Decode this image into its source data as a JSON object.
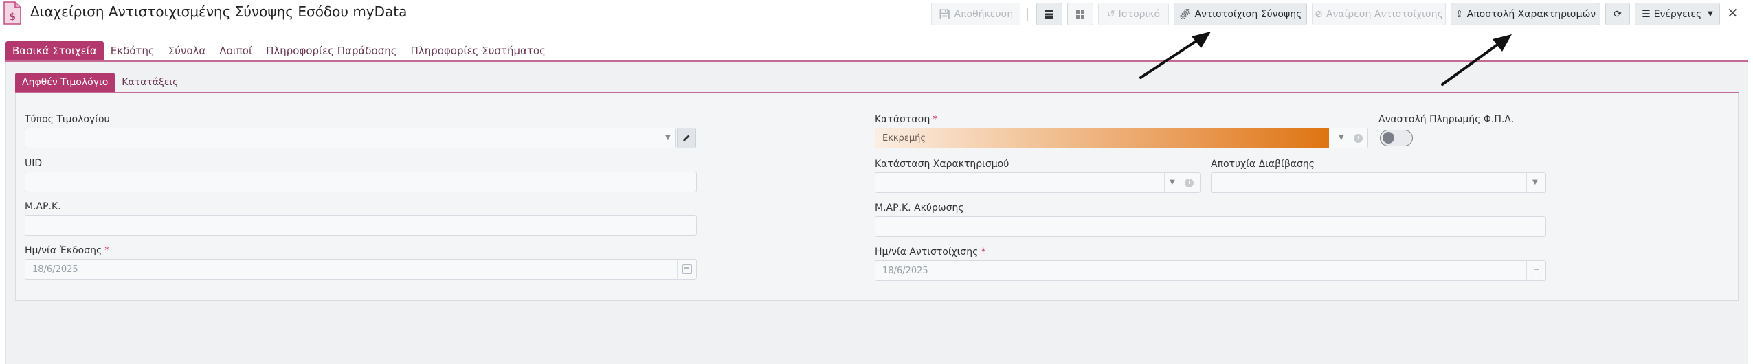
{
  "header": {
    "title": "Διαχείριση Αντιστοιχισμένης Σύνοψης Εσόδου myData",
    "icon": "document-dollar-icon",
    "accent": "#b3386e"
  },
  "toolbar": {
    "save_label": "Αποθήκευση",
    "history_label": "Ιστορικό",
    "match_label": "Αντιστοίχιση Σύνοψης",
    "unmatch_label": "Αναίρεση Αντιστοίχισης",
    "send_label": "Αποστολή Χαρακτηρισμών",
    "actions_label": "Ενέργειες",
    "close_symbol": "×"
  },
  "main_tabs": [
    {
      "label": "Βασικά Στοιχεία"
    },
    {
      "label": "Εκδότης"
    },
    {
      "label": "Σύνολα"
    },
    {
      "label": "Λοιποί"
    },
    {
      "label": "Πληροφορίες Παράδοσης"
    },
    {
      "label": "Πληροφορίες Συστήματος"
    }
  ],
  "sub_tabs": [
    {
      "label": "Ληφθέν Τιμολόγιο"
    },
    {
      "label": "Κατατάξεις"
    }
  ],
  "form": {
    "invoice_type_label": "Τύπος Τιμολογίου",
    "invoice_type_value": "",
    "uid_label": "UID",
    "uid_value": "",
    "mark_label": "Μ.ΑΡ.Κ.",
    "mark_value": "",
    "issue_date_label": "Ημ/νία Έκδοσης",
    "issue_date_value": "18/6/2025",
    "status_label": "Κατάσταση",
    "status_value": "Εκκρεμής",
    "status_color": "#de7412",
    "vat_suspension_label": "Αναστολή Πληρωμής Φ.Π.Α.",
    "vat_suspension_on": false,
    "classification_status_label": "Κατάσταση Χαρακτηρισμού",
    "classification_status_value": "",
    "transmission_failure_label": "Αποτυχία Διαβίβασης",
    "transmission_failure_value": "",
    "cancel_mark_label": "Μ.ΑΡ.Κ. Ακύρωσης",
    "cancel_mark_value": "",
    "match_date_label": "Ημ/νία Αντιστοίχισης",
    "match_date_value": "18/6/2025",
    "required_marker": "*"
  }
}
